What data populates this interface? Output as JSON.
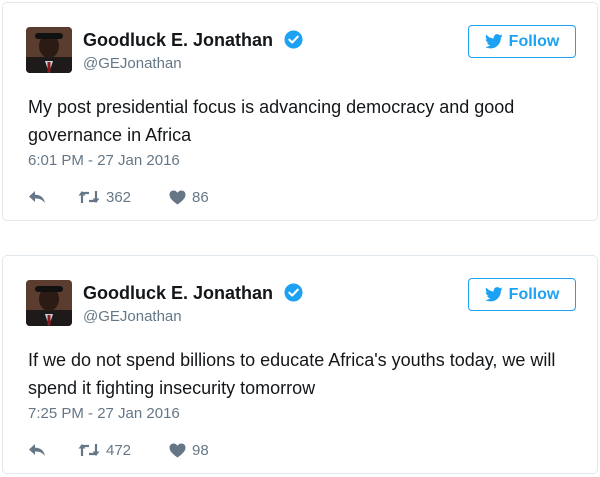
{
  "tweets": [
    {
      "name": "Goodluck E. Jonathan",
      "handle": "@GEJonathan",
      "follow_label": "Follow",
      "text": "My post presidential focus is advancing democracy and good governance in Africa",
      "timestamp": "6:01 PM - 27 Jan 2016",
      "retweets": "362",
      "likes": "86"
    },
    {
      "name": "Goodluck E. Jonathan",
      "handle": "@GEJonathan",
      "follow_label": "Follow",
      "text": "If we do not spend billions to educate Africa's youths today, we will spend it fighting insecurity tomorrow",
      "timestamp": "7:25 PM - 27 Jan 2016",
      "retweets": "472",
      "likes": "98"
    }
  ],
  "colors": {
    "accent": "#1da1f2",
    "text": "#14171a",
    "muted": "#657786",
    "border": "#e1e8ed"
  },
  "icons": [
    "verified-badge-icon",
    "twitter-bird-icon",
    "reply-icon",
    "retweet-icon",
    "heart-icon"
  ]
}
